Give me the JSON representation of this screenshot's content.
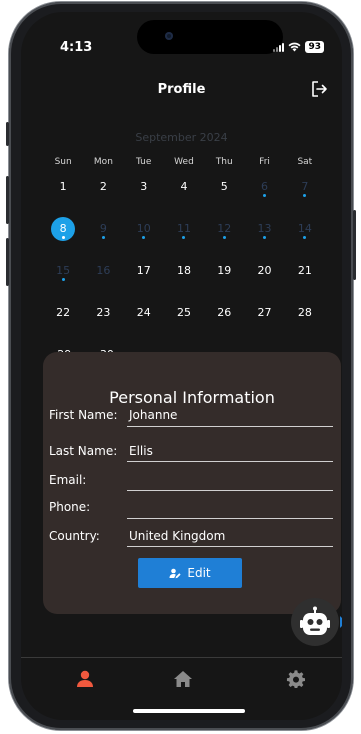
{
  "status_bar": {
    "time": "4:13",
    "battery": "93"
  },
  "header": {
    "title": "Profile",
    "logout_icon": "logout-icon"
  },
  "calendar": {
    "month_label": "September 2024",
    "weekdays": [
      "Sun",
      "Mon",
      "Tue",
      "Wed",
      "Thu",
      "Fri",
      "Sat"
    ],
    "weeks": [
      [
        {
          "d": "1"
        },
        {
          "d": "2"
        },
        {
          "d": "3"
        },
        {
          "d": "4"
        },
        {
          "d": "5"
        },
        {
          "d": "6",
          "dim": true,
          "dot": true
        },
        {
          "d": "7",
          "dim": true,
          "dot": true
        }
      ],
      [
        {
          "d": "8",
          "selected": true,
          "dot": true
        },
        {
          "d": "9",
          "dim": true,
          "dot": true
        },
        {
          "d": "10",
          "dim": true,
          "dot": true
        },
        {
          "d": "11",
          "dim": true,
          "dot": true
        },
        {
          "d": "12",
          "dim": true,
          "dot": true
        },
        {
          "d": "13",
          "dim": true,
          "dot": true
        },
        {
          "d": "14",
          "dim": true,
          "dot": true
        }
      ],
      [
        {
          "d": "15",
          "dim": true,
          "dot": true
        },
        {
          "d": "16",
          "dim": true
        },
        {
          "d": "17"
        },
        {
          "d": "18"
        },
        {
          "d": "19"
        },
        {
          "d": "20"
        },
        {
          "d": "21"
        }
      ],
      [
        {
          "d": "22"
        },
        {
          "d": "23"
        },
        {
          "d": "24"
        },
        {
          "d": "25"
        },
        {
          "d": "26"
        },
        {
          "d": "27"
        },
        {
          "d": "28"
        }
      ],
      [
        {
          "d": "29"
        },
        {
          "d": "30"
        }
      ]
    ],
    "accent_color": "#1da1e8"
  },
  "personal_info": {
    "title": "Personal Information",
    "first_name_label": "First Name:",
    "first_name_value": "Johanne",
    "last_name_label": "Last Name:",
    "last_name_value": "Ellis",
    "email_label": "Email:",
    "email_value": "",
    "phone_label": "Phone:",
    "phone_value": "",
    "country_label": "Country:",
    "country_value": "United Kingdom",
    "edit_label": "Edit",
    "edit_icon": "user-edit-icon"
  },
  "chatbot": {
    "icon": "robot-icon"
  },
  "tab_bar": {
    "items": [
      {
        "icon": "user-icon",
        "active": true,
        "color": "#f0593e"
      },
      {
        "icon": "home-icon",
        "active": false
      },
      {
        "icon": "gear-icon",
        "active": false
      }
    ]
  }
}
